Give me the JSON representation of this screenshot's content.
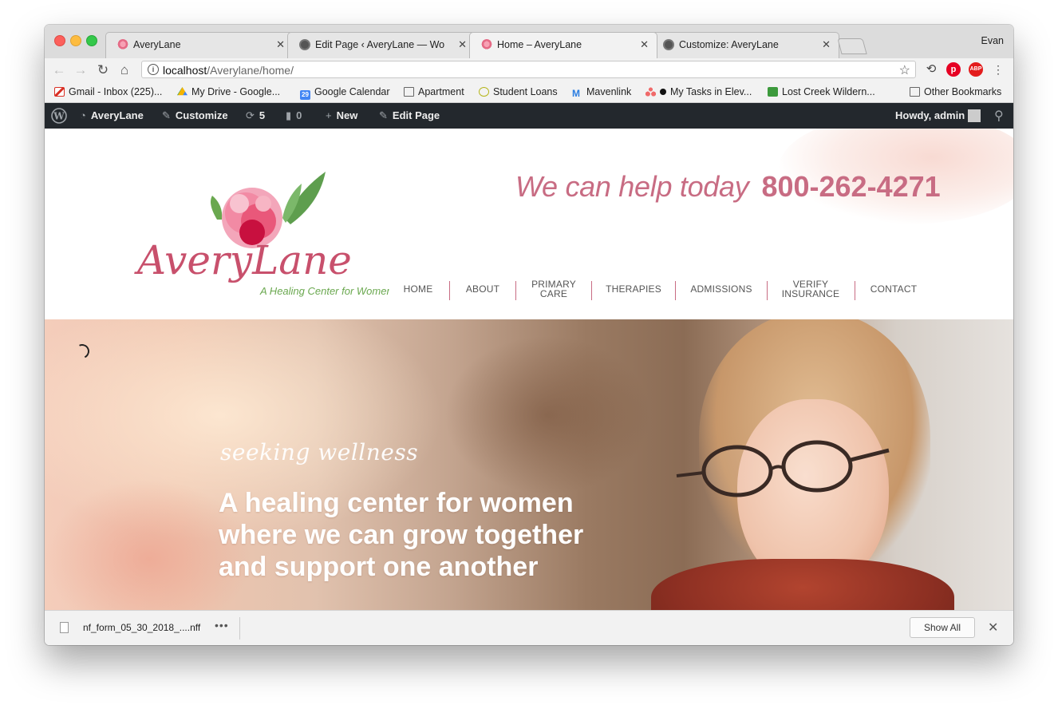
{
  "browser": {
    "tabs": [
      {
        "title": "AveryLane",
        "active": false
      },
      {
        "title": "Edit Page ‹ AveryLane — Word",
        "active": false
      },
      {
        "title": "Home – AveryLane",
        "active": true
      },
      {
        "title": "Customize: AveryLane",
        "active": false
      }
    ],
    "profile_name": "Evan",
    "url_host": "localhost",
    "url_path": "/Averylane/home/",
    "extensions": [
      "sync-icon",
      "pinterest-icon",
      "adblock-icon",
      "menu-icon"
    ],
    "abp_label": "ABP"
  },
  "bookmarks": {
    "items": [
      "Gmail - Inbox (225)...",
      "My Drive - Google...",
      "Google Calendar",
      "Apartment",
      "Student Loans",
      "Mavenlink",
      "My Tasks in Elev...",
      "Lost Creek Wildern..."
    ],
    "calendar_day": "29",
    "other": "Other Bookmarks"
  },
  "adminbar": {
    "site_name": "AveryLane",
    "customize": "Customize",
    "updates_count": "5",
    "comments_count": "0",
    "new_label": "New",
    "edit_page": "Edit Page",
    "howdy": "Howdy, admin"
  },
  "site": {
    "logo_text": "AveryLane",
    "logo_subtitle": "A Healing Center for Women",
    "tagline": "We can help today",
    "phone": "800-262-4271",
    "nav": [
      {
        "line1": "HOME",
        "line2": ""
      },
      {
        "line1": "ABOUT",
        "line2": ""
      },
      {
        "line1": "PRIMARY",
        "line2": "CARE"
      },
      {
        "line1": "THERAPIES",
        "line2": ""
      },
      {
        "line1": "ADMISSIONS",
        "line2": ""
      },
      {
        "line1": "VERIFY",
        "line2": "INSURANCE"
      },
      {
        "line1": "CONTACT",
        "line2": ""
      }
    ],
    "accent_color": "#c86c83",
    "logo_green": "#6aa84f"
  },
  "hero": {
    "script_text": "seeking wellness",
    "headline": [
      "A healing center for women",
      "where we can grow together",
      "and support one another"
    ]
  },
  "downloads": {
    "filename": "nf_form_05_30_2018_....nff",
    "show_all": "Show All"
  }
}
